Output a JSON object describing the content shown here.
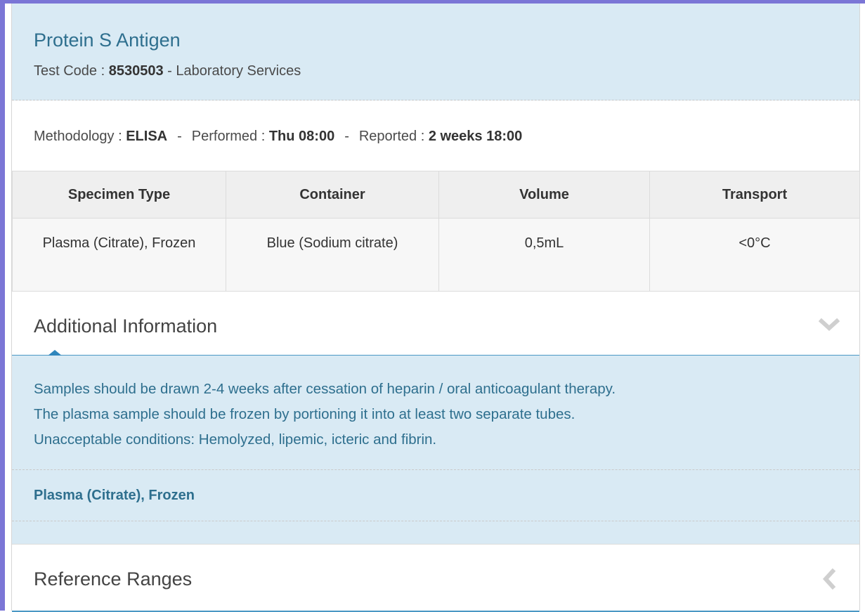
{
  "test": {
    "title": "Protein S Antigen",
    "code_label": "Test Code : ",
    "code": "8530503",
    "department": " - Laboratory Services"
  },
  "method": {
    "methodology_label": "Methodology : ",
    "methodology": "ELISA",
    "performed_label": "Performed : ",
    "performed": "Thu 08:00",
    "reported_label": "Reported : ",
    "reported": "2 weeks 18:00",
    "separator": "-"
  },
  "specimen_table": {
    "headers": [
      "Specimen Type",
      "Container",
      "Volume",
      "Transport"
    ],
    "rows": [
      [
        "Plasma (Citrate), Frozen",
        "Blue (Sodium citrate)",
        "0,5mL",
        "<0°C"
      ]
    ]
  },
  "additional_info": {
    "title": "Additional Information",
    "expanded": true,
    "lines": [
      "Samples should be drawn 2-4 weeks after cessation of heparin / oral anticoagulant therapy.",
      "The plasma sample should be frozen by portioning it into at least two separate tubes.",
      "Unacceptable conditions: Hemolyzed, lipemic, icteric and fibrin."
    ],
    "specimen": "Plasma (Citrate), Frozen",
    "icon": "chevron-down-icon"
  },
  "reference_ranges": {
    "title": "Reference Ranges",
    "expanded": false,
    "icon": "chevron-left-icon"
  },
  "colors": {
    "accent": "#2e6f8e",
    "header_bg": "#d9eaf4",
    "frame": "#7b76d6",
    "panel_border": "#4a97c4"
  }
}
